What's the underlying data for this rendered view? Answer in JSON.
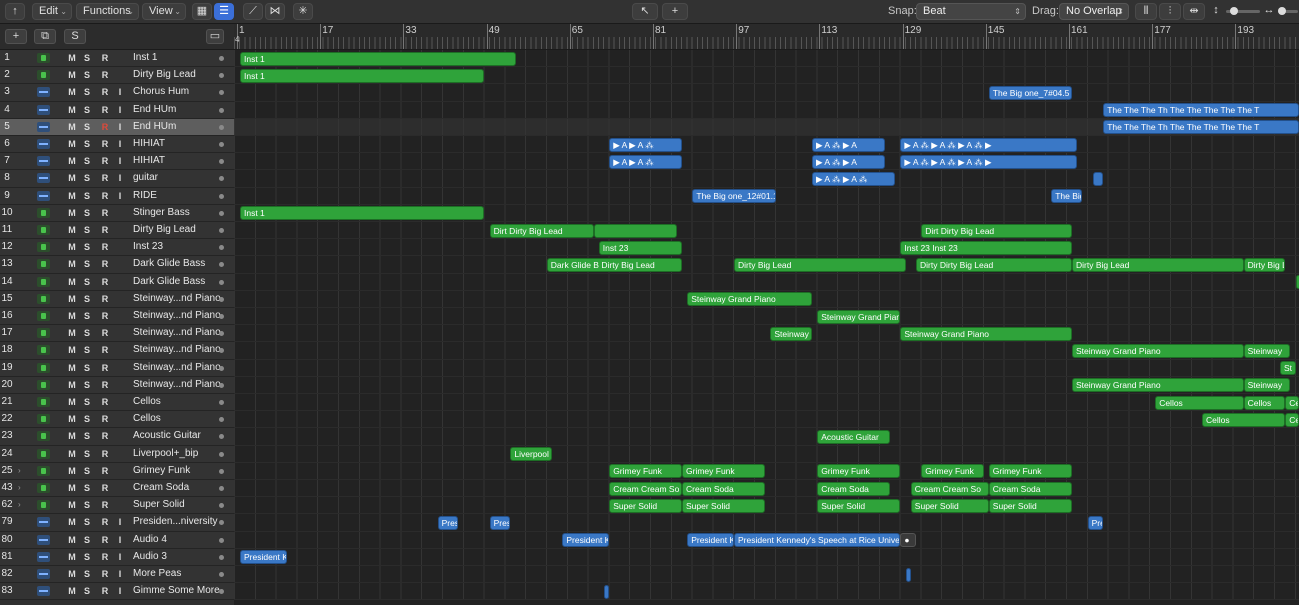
{
  "toolbar": {
    "edit_label": "Edit",
    "functions_label": "Functions",
    "view_label": "View",
    "snap_label": "Snap:",
    "snap_value": "Beat",
    "drag_label": "Drag:",
    "drag_value": "No Overlap"
  },
  "header": {
    "add_label": "+",
    "solo_label": "S"
  },
  "ruler": {
    "bars": [
      "1",
      "17",
      "33",
      "49",
      "65",
      "81",
      "97",
      "113",
      "129",
      "145",
      "161",
      "177",
      "193"
    ]
  },
  "tracks": [
    {
      "num": "1",
      "name": "Inst 1",
      "kind": "inst",
      "m": "M",
      "s": "S",
      "r": "R",
      "i": ""
    },
    {
      "num": "2",
      "name": "Dirty Big Lead",
      "kind": "inst",
      "m": "M",
      "s": "S",
      "r": "R",
      "i": ""
    },
    {
      "num": "3",
      "name": "Chorus Hum",
      "kind": "audio",
      "m": "M",
      "s": "S",
      "r": "R",
      "i": "I"
    },
    {
      "num": "4",
      "name": "End HUm",
      "kind": "audio",
      "m": "M",
      "s": "S",
      "r": "R",
      "i": "I"
    },
    {
      "num": "5",
      "name": "End HUm",
      "kind": "audio",
      "m": "M",
      "s": "S",
      "r": "R",
      "i": "I",
      "selected": true,
      "rec_on": true
    },
    {
      "num": "6",
      "name": "HIHIAT",
      "kind": "audio",
      "m": "M",
      "s": "S",
      "r": "R",
      "i": "I"
    },
    {
      "num": "7",
      "name": "HIHIAT",
      "kind": "audio",
      "m": "M",
      "s": "S",
      "r": "R",
      "i": "I"
    },
    {
      "num": "8",
      "name": "guitar",
      "kind": "audio",
      "m": "M",
      "s": "S",
      "r": "R",
      "i": "I"
    },
    {
      "num": "9",
      "name": "RIDE",
      "kind": "audio",
      "m": "M",
      "s": "S",
      "r": "R",
      "i": "I"
    },
    {
      "num": "10",
      "name": "Stinger Bass",
      "kind": "inst",
      "m": "M",
      "s": "S",
      "r": "R",
      "i": ""
    },
    {
      "num": "11",
      "name": "Dirty Big Lead",
      "kind": "inst",
      "m": "M",
      "s": "S",
      "r": "R",
      "i": ""
    },
    {
      "num": "12",
      "name": "Inst 23",
      "kind": "inst",
      "m": "M",
      "s": "S",
      "r": "R",
      "i": ""
    },
    {
      "num": "13",
      "name": "Dark Glide Bass",
      "kind": "inst",
      "m": "M",
      "s": "S",
      "r": "R",
      "i": ""
    },
    {
      "num": "14",
      "name": "Dark Glide Bass",
      "kind": "inst",
      "m": "M",
      "s": "S",
      "r": "R",
      "i": ""
    },
    {
      "num": "15",
      "name": "Steinway...nd Piano",
      "kind": "inst",
      "m": "M",
      "s": "S",
      "r": "R",
      "i": ""
    },
    {
      "num": "16",
      "name": "Steinway...nd Piano",
      "kind": "inst",
      "m": "M",
      "s": "S",
      "r": "R",
      "i": ""
    },
    {
      "num": "17",
      "name": "Steinway...nd Piano",
      "kind": "inst",
      "m": "M",
      "s": "S",
      "r": "R",
      "i": ""
    },
    {
      "num": "18",
      "name": "Steinway...nd Piano",
      "kind": "inst",
      "m": "M",
      "s": "S",
      "r": "R",
      "i": ""
    },
    {
      "num": "19",
      "name": "Steinway...nd Piano",
      "kind": "inst",
      "m": "M",
      "s": "S",
      "r": "R",
      "i": ""
    },
    {
      "num": "20",
      "name": "Steinway...nd Piano",
      "kind": "inst",
      "m": "M",
      "s": "S",
      "r": "R",
      "i": ""
    },
    {
      "num": "21",
      "name": "Cellos",
      "kind": "inst",
      "m": "M",
      "s": "S",
      "r": "R",
      "i": ""
    },
    {
      "num": "22",
      "name": "Cellos",
      "kind": "inst",
      "m": "M",
      "s": "S",
      "r": "R",
      "i": ""
    },
    {
      "num": "23",
      "name": "Acoustic Guitar",
      "kind": "inst",
      "m": "M",
      "s": "S",
      "r": "R",
      "i": ""
    },
    {
      "num": "24",
      "name": "Liverpool+_bip",
      "kind": "inst",
      "m": "M",
      "s": "S",
      "r": "R",
      "i": ""
    },
    {
      "num": "25",
      "name": "Grimey Funk",
      "kind": "inst",
      "disc": true,
      "m": "M",
      "s": "S",
      "r": "R",
      "i": ""
    },
    {
      "num": "43",
      "name": "Cream Soda",
      "kind": "inst",
      "disc": true,
      "m": "M",
      "s": "S",
      "r": "R",
      "i": ""
    },
    {
      "num": "62",
      "name": "Super Solid",
      "kind": "inst",
      "disc": true,
      "m": "M",
      "s": "S",
      "r": "R",
      "i": ""
    },
    {
      "num": "79",
      "name": "Presiden...niversity",
      "kind": "audio",
      "m": "M",
      "s": "S",
      "r": "R",
      "i": "I"
    },
    {
      "num": "80",
      "name": "Audio 4",
      "kind": "audio",
      "m": "M",
      "s": "S",
      "r": "R",
      "i": "I"
    },
    {
      "num": "81",
      "name": "Audio 3",
      "kind": "audio",
      "m": "M",
      "s": "S",
      "r": "R",
      "i": "I"
    },
    {
      "num": "82",
      "name": "More Peas",
      "kind": "audio",
      "m": "M",
      "s": "S",
      "r": "R",
      "i": "I"
    },
    {
      "num": "83",
      "name": "Gimme Some More",
      "kind": "audio",
      "m": "M",
      "s": "S",
      "r": "R",
      "i": "I"
    }
  ],
  "regions": [
    {
      "track": 0,
      "bar": 1,
      "len": 53,
      "label": "Inst 1",
      "type": "midi"
    },
    {
      "track": 1,
      "bar": 1,
      "len": 47,
      "label": "Inst 1",
      "type": "midi"
    },
    {
      "track": 2,
      "bar": 145,
      "len": 16,
      "label": "The Big one_7#04.5",
      "type": "audio"
    },
    {
      "track": 3,
      "bar": 167,
      "len": 40,
      "label": "The  The  The  Th  The  The  The  The  The  T",
      "type": "audio"
    },
    {
      "track": 4,
      "bar": 167,
      "len": 40,
      "label": "The  The  The  Th  The  The  The  The  The  T",
      "type": "audio"
    },
    {
      "track": 5,
      "bar": 72,
      "len": 14,
      "label": "▶ A  ▶ A ⁂",
      "type": "audio"
    },
    {
      "track": 5,
      "bar": 111,
      "len": 14,
      "label": "▶ A ⁂  ▶ A",
      "type": "audio"
    },
    {
      "track": 5,
      "bar": 128,
      "len": 34,
      "label": "▶ A ⁂  ▶ A ⁂  ▶ A ⁂  ▶",
      "type": "audio"
    },
    {
      "track": 6,
      "bar": 72,
      "len": 14,
      "label": "▶ A  ▶ A ⁂",
      "type": "audio"
    },
    {
      "track": 6,
      "bar": 111,
      "len": 14,
      "label": "▶ A ⁂  ▶ A",
      "type": "audio"
    },
    {
      "track": 6,
      "bar": 128,
      "len": 34,
      "label": "▶ A ⁂  ▶ A ⁂  ▶ A ⁂  ▶",
      "type": "audio"
    },
    {
      "track": 7,
      "bar": 111,
      "len": 16,
      "label": "▶ A ⁂  ▶ A ⁂",
      "type": "audio"
    },
    {
      "track": 7,
      "bar": 165,
      "len": 2,
      "label": "",
      "type": "audio"
    },
    {
      "track": 8,
      "bar": 88,
      "len": 16,
      "label": "The Big one_12#01.1",
      "type": "audio"
    },
    {
      "track": 8,
      "bar": 157,
      "len": 6,
      "label": "The Big",
      "type": "audio"
    },
    {
      "track": 9,
      "bar": 1,
      "len": 47,
      "label": "Inst 1",
      "type": "midi"
    },
    {
      "track": 10,
      "bar": 49,
      "len": 20,
      "label": "Dirt  Dirty Big Lead",
      "type": "midi"
    },
    {
      "track": 10,
      "bar": 69,
      "len": 16,
      "label": "",
      "type": "midi"
    },
    {
      "track": 10,
      "bar": 132,
      "len": 29,
      "label": "Dirt  Dirty Big Lead",
      "type": "midi"
    },
    {
      "track": 11,
      "bar": 70,
      "len": 16,
      "label": "Inst 23",
      "type": "midi"
    },
    {
      "track": 11,
      "bar": 128,
      "len": 33,
      "label": "Inst 23               Inst 23",
      "type": "midi"
    },
    {
      "track": 12,
      "bar": 60,
      "len": 26,
      "label": "Dark Glide B  Dirty Big Lead",
      "type": "midi"
    },
    {
      "track": 12,
      "bar": 96,
      "len": 33,
      "label": "Dirty Big Lead",
      "type": "midi"
    },
    {
      "track": 12,
      "bar": 131,
      "len": 30,
      "label": "Dirty  Dirty Big Lead",
      "type": "midi"
    },
    {
      "track": 12,
      "bar": 161,
      "len": 33,
      "label": "Dirty Big Lead",
      "type": "midi"
    },
    {
      "track": 12,
      "bar": 194,
      "len": 8,
      "label": "Dirty Big L",
      "type": "midi"
    },
    {
      "track": 13,
      "bar": 204,
      "len": 4,
      "label": "Dirt",
      "type": "midi"
    },
    {
      "track": 14,
      "bar": 87,
      "len": 24,
      "label": "Steinway Grand Piano",
      "type": "midi"
    },
    {
      "track": 15,
      "bar": 112,
      "len": 16,
      "label": "Steinway Grand Piano",
      "type": "midi"
    },
    {
      "track": 16,
      "bar": 103,
      "len": 8,
      "label": "Steinway",
      "type": "midi"
    },
    {
      "track": 16,
      "bar": 128,
      "len": 33,
      "label": "Steinway Grand Piano",
      "type": "midi"
    },
    {
      "track": 17,
      "bar": 161,
      "len": 33,
      "label": "Steinway Grand Piano",
      "type": "midi"
    },
    {
      "track": 17,
      "bar": 194,
      "len": 9,
      "label": "Steinway",
      "type": "midi"
    },
    {
      "track": 18,
      "bar": 201,
      "len": 3,
      "label": "St",
      "type": "midi"
    },
    {
      "track": 19,
      "bar": 161,
      "len": 33,
      "label": "Steinway Grand Piano",
      "type": "midi"
    },
    {
      "track": 19,
      "bar": 194,
      "len": 9,
      "label": "Steinway",
      "type": "midi"
    },
    {
      "track": 20,
      "bar": 177,
      "len": 17,
      "label": "Cellos",
      "type": "midi"
    },
    {
      "track": 20,
      "bar": 194,
      "len": 8,
      "label": "Cellos",
      "type": "midi"
    },
    {
      "track": 20,
      "bar": 202,
      "len": 4,
      "label": "Cel",
      "type": "midi"
    },
    {
      "track": 21,
      "bar": 186,
      "len": 16,
      "label": "Cellos",
      "type": "midi"
    },
    {
      "track": 21,
      "bar": 202,
      "len": 4,
      "label": "Cel",
      "type": "midi"
    },
    {
      "track": 22,
      "bar": 112,
      "len": 14,
      "label": "Acoustic Guitar",
      "type": "midi"
    },
    {
      "track": 23,
      "bar": 53,
      "len": 8,
      "label": "Liverpool",
      "type": "midi"
    },
    {
      "track": 24,
      "bar": 72,
      "len": 14,
      "label": "Grimey Funk",
      "type": "midi"
    },
    {
      "track": 24,
      "bar": 86,
      "len": 16,
      "label": "Grimey Funk",
      "type": "midi"
    },
    {
      "track": 24,
      "bar": 112,
      "len": 16,
      "label": "Grimey Funk",
      "type": "midi"
    },
    {
      "track": 24,
      "bar": 132,
      "len": 12,
      "label": "Grimey Funk",
      "type": "midi"
    },
    {
      "track": 24,
      "bar": 145,
      "len": 16,
      "label": "Grimey Funk",
      "type": "midi"
    },
    {
      "track": 25,
      "bar": 72,
      "len": 14,
      "label": "Cream  Cream So",
      "type": "midi"
    },
    {
      "track": 25,
      "bar": 86,
      "len": 16,
      "label": "Cream Soda",
      "type": "midi"
    },
    {
      "track": 25,
      "bar": 112,
      "len": 14,
      "label": "Cream Soda",
      "type": "midi"
    },
    {
      "track": 25,
      "bar": 130,
      "len": 15,
      "label": "Cream  Cream So",
      "type": "midi"
    },
    {
      "track": 25,
      "bar": 145,
      "len": 16,
      "label": "Cream Soda",
      "type": "midi"
    },
    {
      "track": 26,
      "bar": 72,
      "len": 14,
      "label": "Super Solid",
      "type": "midi"
    },
    {
      "track": 26,
      "bar": 86,
      "len": 16,
      "label": "Super Solid",
      "type": "midi"
    },
    {
      "track": 26,
      "bar": 112,
      "len": 16,
      "label": "Super Solid",
      "type": "midi"
    },
    {
      "track": 26,
      "bar": 130,
      "len": 15,
      "label": "Super Solid",
      "type": "midi"
    },
    {
      "track": 26,
      "bar": 145,
      "len": 16,
      "label": "Super Solid",
      "type": "midi"
    },
    {
      "track": 27,
      "bar": 39,
      "len": 4,
      "label": "Presi",
      "type": "audio"
    },
    {
      "track": 27,
      "bar": 49,
      "len": 4,
      "label": "Presi",
      "type": "audio"
    },
    {
      "track": 27,
      "bar": 164,
      "len": 3,
      "label": "Pre",
      "type": "audio"
    },
    {
      "track": 28,
      "bar": 63,
      "len": 9,
      "label": "President K",
      "type": "audio"
    },
    {
      "track": 28,
      "bar": 87,
      "len": 9,
      "label": "President K",
      "type": "audio"
    },
    {
      "track": 28,
      "bar": 96,
      "len": 32,
      "label": "President Kennedy's Speech at Rice Universit",
      "type": "audio"
    },
    {
      "track": 28,
      "bar": 128,
      "len": 3,
      "label": "●",
      "type": "dark"
    },
    {
      "track": 29,
      "bar": 1,
      "len": 9,
      "label": "President K",
      "type": "audio"
    },
    {
      "track": 30,
      "bar": 129,
      "len": 1,
      "label": "",
      "type": "audio"
    },
    {
      "track": 31,
      "bar": 71,
      "len": 1,
      "label": "",
      "type": "audio"
    }
  ]
}
